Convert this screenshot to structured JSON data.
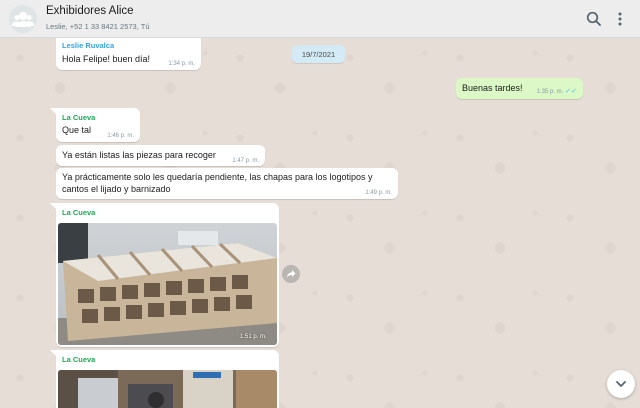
{
  "header": {
    "title": "Exhibidores Alice",
    "subtitle": "Leslie, +52 1 33 8421 2573, Tú",
    "avatar_icon": "group-avatar-icon",
    "search_icon": "search-icon",
    "menu_icon": "kebab-menu-icon"
  },
  "date_separator": "19/7/2021",
  "messages": [
    {
      "sender": "Leslie Ruvalca",
      "text": "Hola Felipe! buen día!",
      "time": "1:34 p. m."
    },
    {
      "sender": "",
      "text": "Buenas tardes!",
      "time": "1:35 p. m.",
      "outgoing": true,
      "status": "read"
    },
    {
      "sender": "La Cueva",
      "text": "Que tal",
      "time": "1:46 p. m."
    },
    {
      "sender": "",
      "text": "Ya están listas las piezas para recoger",
      "time": "1:47 p. m."
    },
    {
      "sender": "",
      "text_line1": "Ya prácticamente solo les quedaría pendiente, las chapas para los logotipos y",
      "text_line2": "cantos el lijado y barnizado",
      "time": "1:49 p. m."
    },
    {
      "sender": "La Cueva",
      "image": "wood-display-shelves-photo",
      "time": "1:51 p. m."
    },
    {
      "sender": "La Cueva",
      "image": "workshop-parts-photo"
    }
  ],
  "colors": {
    "outgoing_bubble": "#dcf8c6",
    "incoming_bubble": "#ffffff",
    "sender_green": "#1fa855",
    "sender_blue": "#35a3e0",
    "date_pill": "#d4eaf4",
    "read_ticks": "#4fb6ec"
  },
  "controls": {
    "forward_icon": "forward-icon",
    "scroll_down_icon": "chevron-down-icon"
  }
}
